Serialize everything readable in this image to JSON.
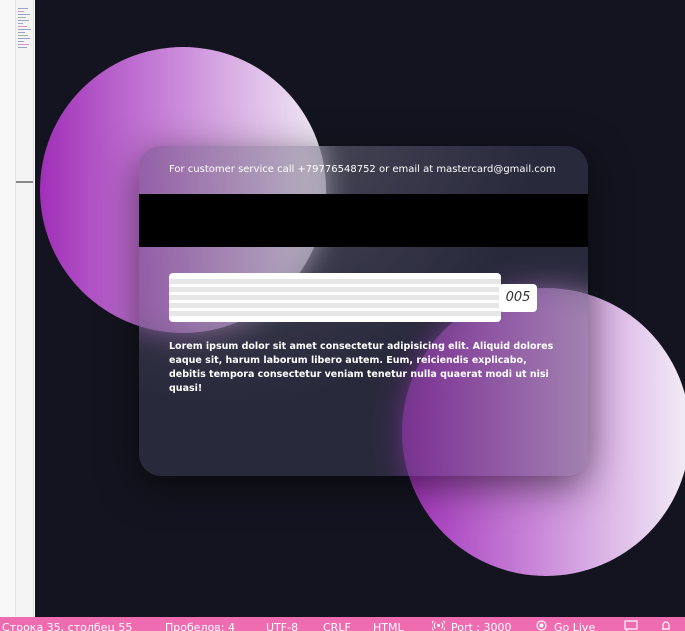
{
  "card": {
    "service_text": "For customer service call +79776548752 or email at mastercard@gmail.com",
    "cvv": "005",
    "description": "Lorem ipsum dolor sit amet consectetur adipisicing elit. Aliquid dolores eaque sit, harum laborum libero autem. Eum, reiciendis explicabo, debitis tempora consectetur veniam tenetur nulla quaerat modi ut nisi quasi!"
  },
  "statusbar": {
    "line_col": "Строка 35, столбец 55",
    "spaces": "Пробелов: 4",
    "encoding": "UTF-8",
    "eol": "CRLF",
    "language": "HTML",
    "port": "Port : 3000",
    "golive": "Go Live",
    "icons": [
      "broadcast-icon",
      "golive-icon",
      "feedback-icon",
      "notification-bell-icon"
    ]
  },
  "colors": {
    "background": "#141420",
    "circle_start": "#a030b8",
    "circle_end": "#f2eef6",
    "statusbar": "#f06cb0"
  }
}
